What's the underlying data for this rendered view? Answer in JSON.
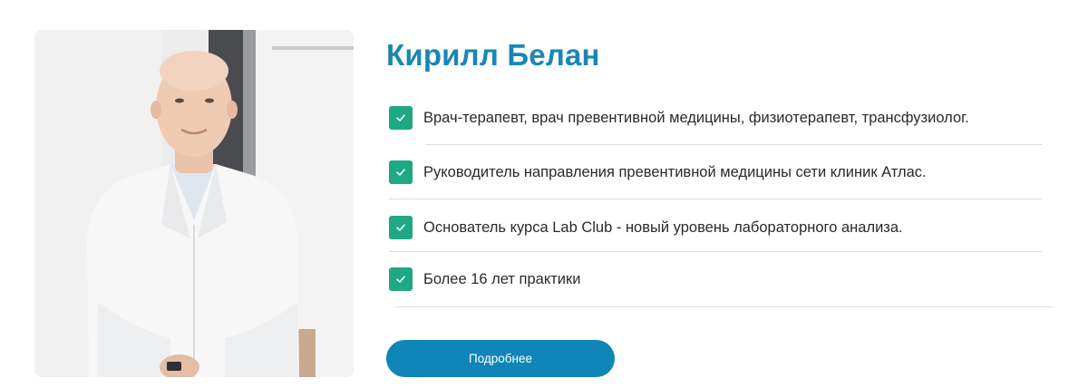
{
  "profile": {
    "name": "Кирилл Белан",
    "photo_icon": "doctor-portrait",
    "accent_color": "#1a86b6",
    "check_color": "#1ea884"
  },
  "facts": [
    {
      "text": "Врач-терапевт, врач превентивной медицины, физиотерапевт, трансфузиолог."
    },
    {
      "text": "Руководитель направления превентивной медицины сети клиник Атлас."
    },
    {
      "text": "Основатель курса Lab Club - новый уровень лабораторного анализа."
    },
    {
      "text": "Более 16 лет практики"
    }
  ],
  "button": {
    "label": "Подробнее",
    "color": "#0f85b8"
  }
}
